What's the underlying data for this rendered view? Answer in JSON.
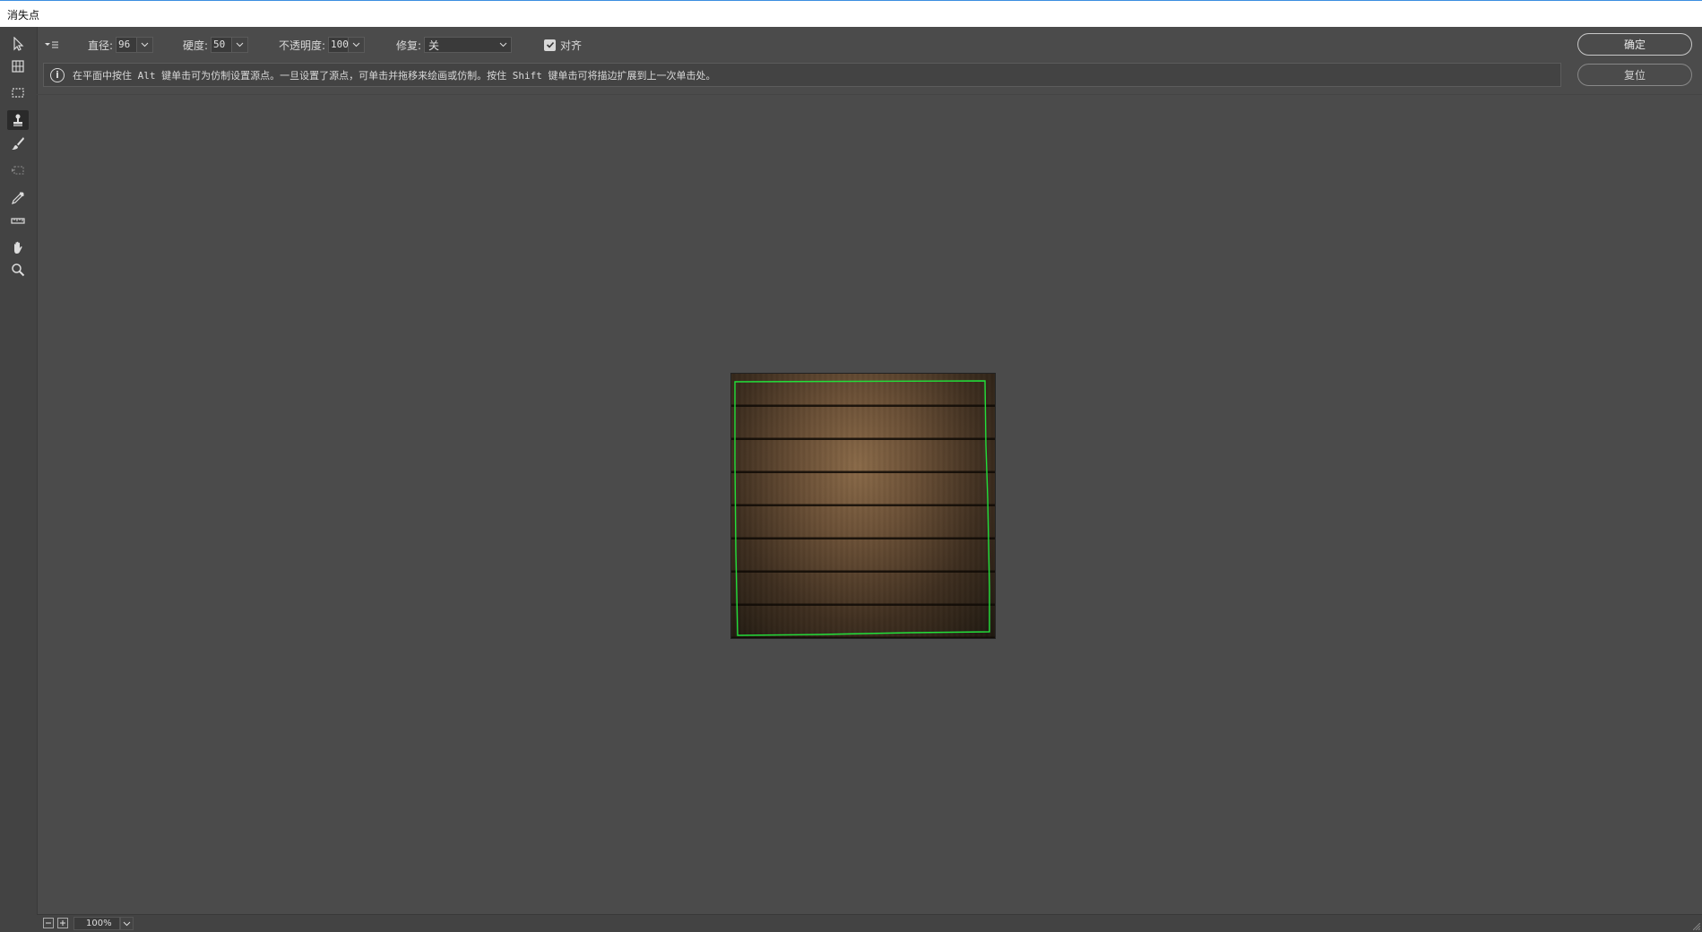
{
  "window": {
    "title": "消失点"
  },
  "options": {
    "menu_icon": "flyout-menu-icon",
    "diameter": {
      "label": "直径:",
      "value": "96"
    },
    "hardness": {
      "label": "硬度:",
      "value": "50"
    },
    "opacity": {
      "label": "不透明度:",
      "value": "100"
    },
    "heal": {
      "label": "修复:",
      "value": "关"
    },
    "align": {
      "label": "对齐",
      "checked": true
    }
  },
  "info": {
    "text": "在平面中按住 Alt 键单击可为仿制设置源点。一旦设置了源点，可单击并拖移来绘画或仿制。按住 Shift 键单击可将描边扩展到上一次单击处。"
  },
  "buttons": {
    "ok": "确定",
    "reset": "复位"
  },
  "tools": [
    {
      "name": "edit-plane-tool",
      "icon": "arrow-icon",
      "active": false
    },
    {
      "name": "create-plane-tool",
      "icon": "grid-plane-icon",
      "active": false
    },
    {
      "name": "marquee-tool",
      "icon": "marquee-icon",
      "active": false
    },
    {
      "name": "stamp-tool",
      "icon": "stamp-icon",
      "active": true
    },
    {
      "name": "brush-tool",
      "icon": "brush-icon",
      "active": false
    },
    {
      "name": "transform-tool",
      "icon": "transform-icon",
      "active": false
    },
    {
      "name": "eyedropper-tool",
      "icon": "eyedropper-icon",
      "active": false
    },
    {
      "name": "measure-tool",
      "icon": "ruler-icon",
      "active": false
    },
    {
      "name": "hand-tool",
      "icon": "hand-icon",
      "active": false
    },
    {
      "name": "zoom-tool",
      "icon": "zoom-icon",
      "active": false
    }
  ],
  "zoom": {
    "value": "100%"
  },
  "colors": {
    "plane_grid": "#22e03a",
    "background": "#4b4b4b",
    "panel": "#434343"
  }
}
